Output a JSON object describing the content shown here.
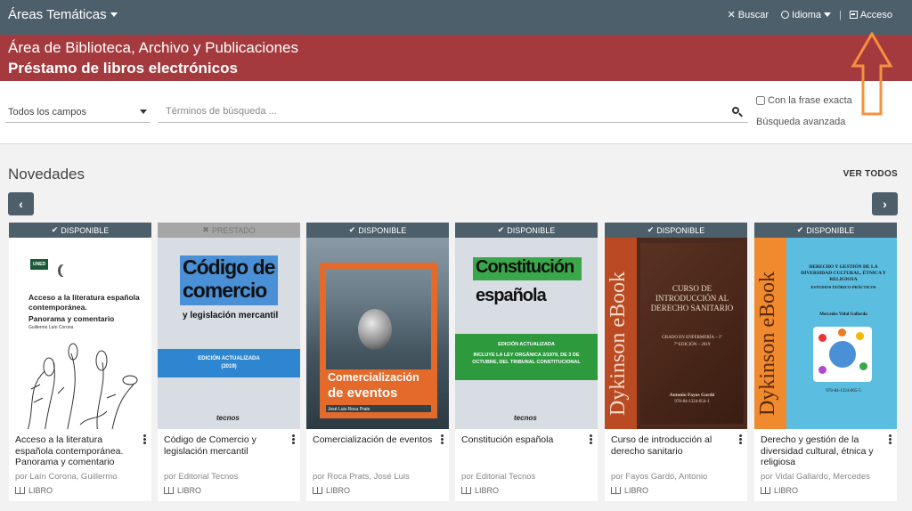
{
  "topbar": {
    "areas_label": "Áreas Temáticas",
    "search_label": "Buscar",
    "language_label": "Idioma",
    "access_label": "Acceso"
  },
  "banner": {
    "area": "Área de Biblioteca, Archivo y Publicaciones",
    "title": "Préstamo de libros electrónicos"
  },
  "search": {
    "field_selected": "Todos los campos",
    "placeholder": "Términos de búsqueda ...",
    "exact_phrase": "Con la frase exacta",
    "advanced": "Búsqueda avanzada"
  },
  "section": {
    "title": "Novedades",
    "see_all": "VER TODOS"
  },
  "colors": {
    "topbar": "#4d5f6b",
    "banner": "#a43a3e",
    "arrow": "#f5913e"
  },
  "books": [
    {
      "status": "DISPONIBLE",
      "status_icon": "check-icon",
      "title": "Acceso a la literatura española contemporánea. Panorama y comentario",
      "author": "por Laín Corona, Guillermo",
      "type": "LIBRO",
      "cover": {
        "logo": "uned",
        "text1": "Acceso a la literatura española contemporánea.",
        "text2": "Panorama y comentario",
        "text3": "Guillermo Laín Corona"
      }
    },
    {
      "status": "PRESTADO",
      "status_icon": "x-icon",
      "title": "Código de Comercio y legislación mercantil",
      "author": "por Editorial Tecnos",
      "type": "LIBRO",
      "cover": {
        "text1": "Código de",
        "text2": "comercio",
        "text3": "y legislación mercantil",
        "text4": "EDICIÓN ACTUALIZADA",
        "text5": "(2019)",
        "text6": "tecnos"
      }
    },
    {
      "status": "DISPONIBLE",
      "status_icon": "check-icon",
      "title": "Comercialización de eventos",
      "author": "por Roca Prats, José Luis",
      "type": "LIBRO",
      "cover": {
        "text1": "Comercialización",
        "text2": "de eventos",
        "text3": "José Luis Roca Prats"
      }
    },
    {
      "status": "DISPONIBLE",
      "status_icon": "check-icon",
      "title": "Constitución española",
      "author": "por Editorial Tecnos",
      "type": "LIBRO",
      "cover": {
        "text1": "Constitución",
        "text2": "española",
        "text3": "EDICIÓN ACTUALIZADA",
        "text4": "INCLUYE LA LEY ORGÁNICA 2/1979, DE 3 DE OCTUBRE, DEL TRIBUNAL CONSTITUCIONAL",
        "text5": "tecnos"
      }
    },
    {
      "status": "DISPONIBLE",
      "status_icon": "check-icon",
      "title": "Curso de introducción al derecho sanitario",
      "author": "por Fayos Gardó, Antonio",
      "type": "LIBRO",
      "cover": {
        "spine": "Dykinson eBook",
        "text1": "CURSO DE INTRODUCCIÓN AL DERECHO SANITARIO",
        "text2": "GRADO EN ENFERMERÍA – 1º",
        "text3": "7ª EDICIÓN – 2019",
        "text4": "Antonio Fayos Gardó",
        "text5": "978-84-1324-054-1"
      }
    },
    {
      "status": "DISPONIBLE",
      "status_icon": "check-icon",
      "title": "Derecho y gestión de la diversidad cultural, étnica y religiosa",
      "author": "por Vidal Gallardo, Mercedes",
      "type": "LIBRO",
      "cover": {
        "spine": "Dykinson eBook",
        "text1": "DERECHO Y GESTIÓN DE LA DIVERSIDAD CULTURAL, ÉTNICA Y RELIGIOSA",
        "text2": "ESTUDIOS TEÓRICO-PRÁCTICOS",
        "text3": "Mercedes Vidal Gallardo",
        "text4": "978-84-1324-065-5"
      }
    }
  ]
}
